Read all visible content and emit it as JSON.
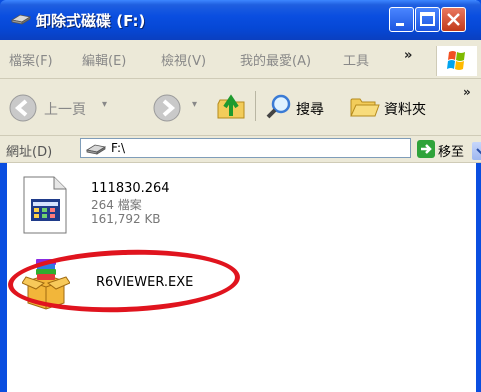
{
  "window": {
    "title": "卸除式磁碟 (F:)"
  },
  "menu": {
    "items": [
      "檔案(F)",
      "編輯(E)",
      "檢視(V)",
      "我的最愛(A)",
      "工具"
    ],
    "overflow": "»"
  },
  "toolbar": {
    "back_label": "上一頁",
    "search_label": "搜尋",
    "folders_label": "資料夾",
    "overflow": "»"
  },
  "address": {
    "label": "網址(D)",
    "value": "F:\\",
    "go_label": "移至"
  },
  "files": [
    {
      "name": "111830.264",
      "type": "264 檔案",
      "size": "161,792 KB",
      "icon": "video-file-icon"
    },
    {
      "name": "R6VIEWER.EXE",
      "icon": "installer-package-icon"
    }
  ],
  "colors": {
    "titlebar": "#0a4ee0",
    "highlight_ellipse": "#e0141e",
    "chrome": "#ece9d8"
  }
}
